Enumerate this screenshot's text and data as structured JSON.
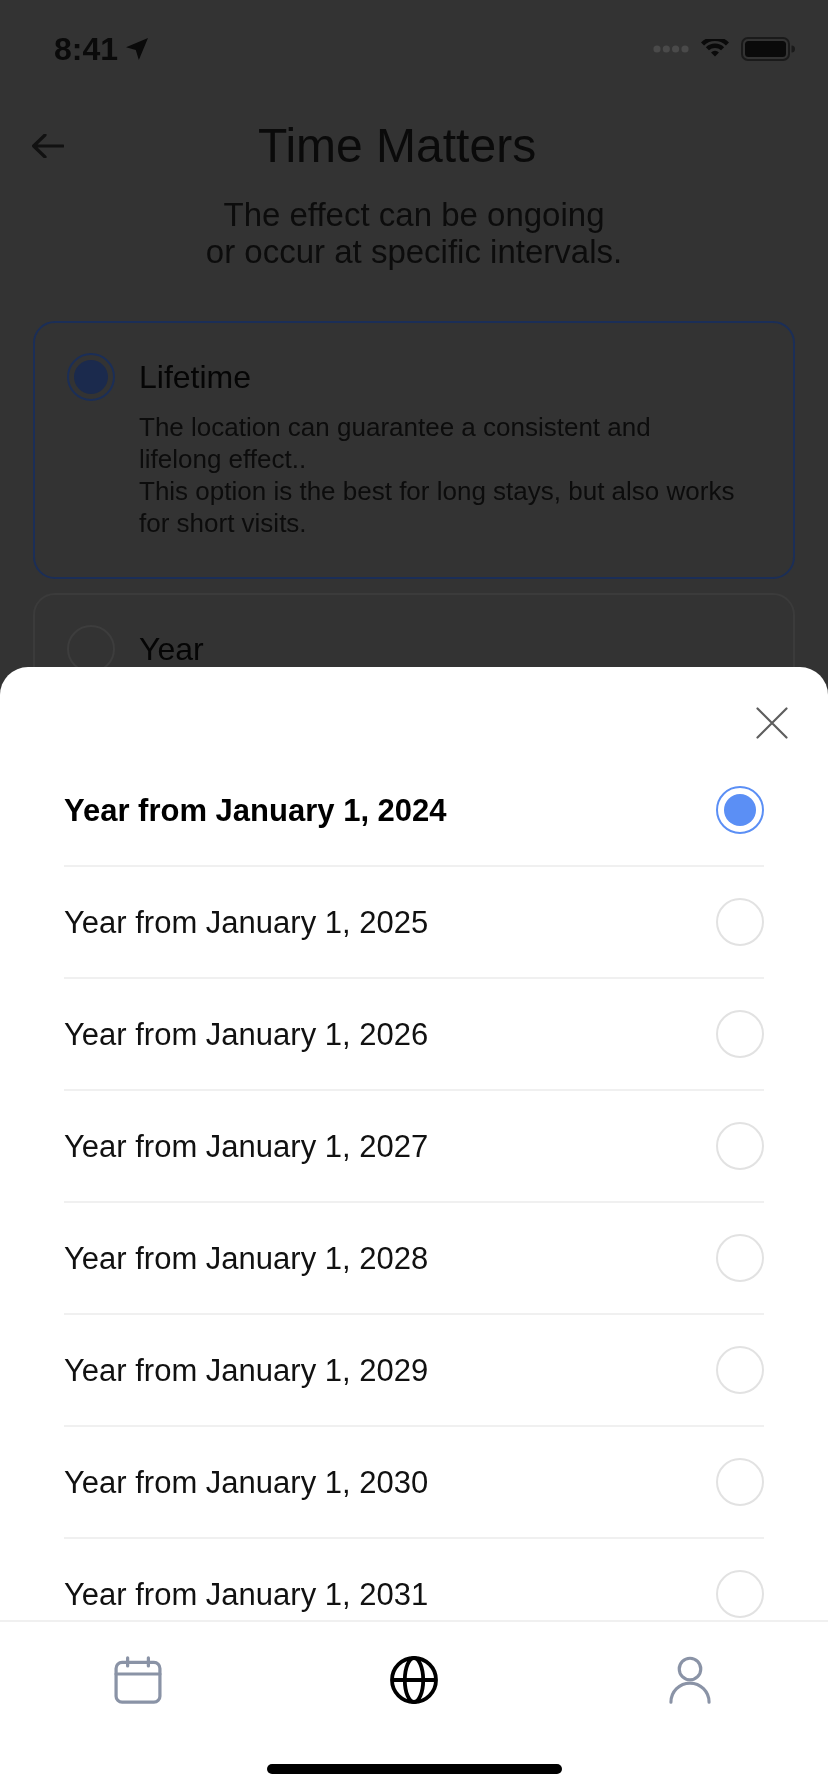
{
  "status_bar": {
    "time": "8:41"
  },
  "header": {
    "title": "Time Matters",
    "subtitle": "The effect can be ongoing\nor occur at specific intervals."
  },
  "options": [
    {
      "title": "Lifetime",
      "description": "The location can guarantee a consistent and\nlifelong effect..\nThis option is the best for long stays, but also works\nfor short visits.",
      "selected": true
    },
    {
      "title": "Year",
      "selected": false
    }
  ],
  "sheet": {
    "items": [
      {
        "label": "Year from January 1, 2024",
        "selected": true
      },
      {
        "label": "Year from January 1, 2025",
        "selected": false
      },
      {
        "label": "Year from January 1, 2026",
        "selected": false
      },
      {
        "label": "Year from January 1, 2027",
        "selected": false
      },
      {
        "label": "Year from January 1, 2028",
        "selected": false
      },
      {
        "label": "Year from January 1, 2029",
        "selected": false
      },
      {
        "label": "Year from January 1, 2030",
        "selected": false
      },
      {
        "label": "Year from January 1, 2031",
        "selected": false
      }
    ]
  },
  "bottom_nav": [
    {
      "kind": "calendar",
      "selected": false
    },
    {
      "kind": "globe",
      "selected": true
    },
    {
      "kind": "user",
      "selected": false
    }
  ]
}
